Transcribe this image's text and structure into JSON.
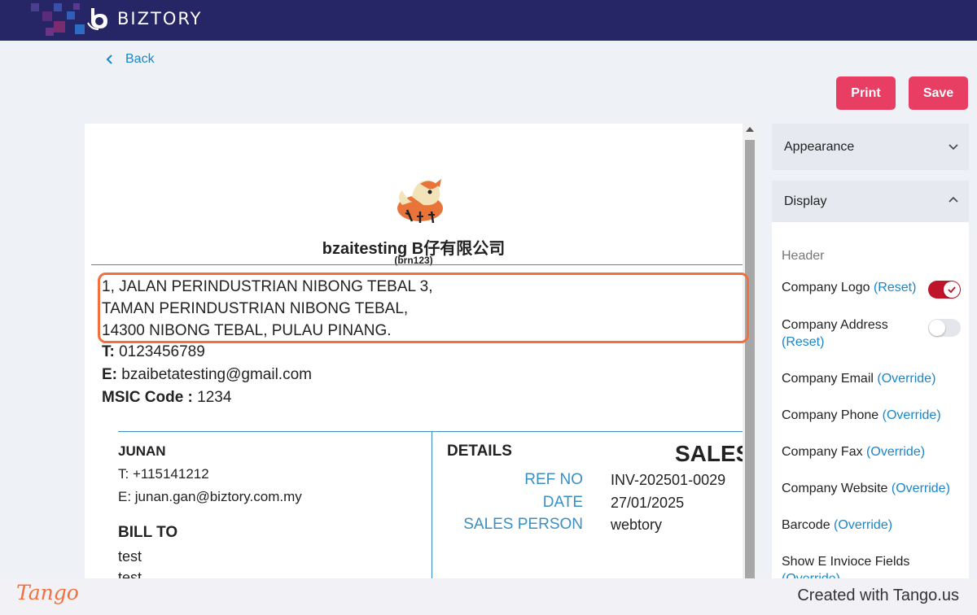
{
  "header": {
    "brand": "BIZTORY"
  },
  "nav": {
    "back_label": "Back"
  },
  "actions": {
    "print_label": "Print",
    "save_label": "Save"
  },
  "document": {
    "company_name": "bzaitesting B仔有限公司",
    "brn": "(brn123)",
    "address": [
      "1, JALAN PERINDUSTRIAN NIBONG TEBAL 3,",
      "TAMAN PERINDUSTRIAN NIBONG TEBAL,",
      "14300 NIBONG TEBAL, PULAU PINANG."
    ],
    "phone_label": "T:",
    "phone": "0123456789",
    "email_label": "E:",
    "email": "bzaibetatesting@gmail.com",
    "msic_label": "MSIC Code :",
    "msic": "1234",
    "customer": {
      "name": "JUNAN",
      "phone": "T: +115141212",
      "email": "E: junan.gan@biztory.com.my"
    },
    "bill_to_label": "BILL TO",
    "bill_to_lines": [
      "test",
      "test"
    ],
    "details_label": "DETAILS",
    "doc_title": "SALES",
    "details": [
      {
        "label": "REF NO",
        "value": "INV-202501-0029"
      },
      {
        "label": "DATE",
        "value": "27/01/2025"
      },
      {
        "label": "SALES PERSON",
        "value": "webtory"
      }
    ]
  },
  "panel": {
    "appearance_label": "Appearance",
    "display_label": "Display",
    "header_section": "Header",
    "options": [
      {
        "label": "Company Logo",
        "link": "(Reset)"
      },
      {
        "label": "Company Address",
        "link": "(Reset)"
      },
      {
        "label": "Company Email",
        "link": "(Override)"
      },
      {
        "label": "Company Phone",
        "link": "(Override)"
      },
      {
        "label": "Company Fax",
        "link": "(Override)"
      },
      {
        "label": "Company Website",
        "link": "(Override)"
      },
      {
        "label": "Barcode",
        "link": "(Override)"
      },
      {
        "label": "Show E Invioce Fields",
        "link": "(Override)"
      }
    ],
    "toggles": {
      "company_logo": true,
      "company_address": false
    }
  },
  "footer": {
    "tango_logo": "Tango",
    "created_text": "Created with Tango.us"
  },
  "colors": {
    "topbar": "#262565",
    "accent_button": "#e83e64",
    "link": "#1a86c9",
    "highlight": "#f2703e",
    "toggle_on": "#c0142a"
  }
}
